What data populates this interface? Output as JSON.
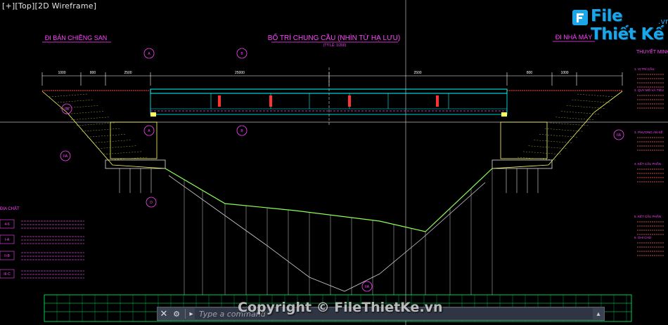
{
  "viewport": {
    "label": "[+][Top][2D Wireframe]"
  },
  "drawing": {
    "title": "BỐ TRÍ CHUNG CẦU (NHÌN TỪ HẠ LƯU)",
    "scale": "(TỶ LỆ: 1/200)",
    "left_heading": "ĐI BẢN CHIỀNG SAN",
    "right_heading": "ĐI NHÀ MÁY",
    "notes_heading": "THUYẾT MINH",
    "notes_items": [
      "1. VỊ TRÍ CẦU:",
      "2. QUY MÔ VÀ TIÊU",
      "3. PHƯƠNG ÁN KẾ",
      "4. KẾT CẤU PHẦN",
      "5. KẾT CẤU PHẦN",
      "6. GHI CHÚ"
    ],
    "geology_heading": "ĐỊA CHẤT",
    "layer_labels": [
      "4-6",
      "I-A",
      "II-B",
      "III-C"
    ],
    "circle_labels": [
      "A",
      "B",
      "A",
      "B",
      "D",
      "IIA",
      "IIB",
      "IIA",
      "IIA"
    ],
    "dims": [
      "1000",
      "800",
      "2500",
      "25000",
      "2500",
      "800",
      "1000"
    ],
    "colors": {
      "background": "#000000",
      "beam": "#00ffff",
      "dim": "#ffffff",
      "ground": "#8cff5a",
      "annotation": "#ff44ff",
      "truss": "#ffff66",
      "pier": "#e0e0e0",
      "water": "#ff3333"
    }
  },
  "logo": {
    "main": "File Thiết Kế",
    "sub": ".vn"
  },
  "watermark": "Copyright © FileThietKe.vn",
  "command": {
    "close_icon": "✕",
    "wrench_icon": "🔧",
    "prompt_icon": "▸",
    "placeholder": "Type a command",
    "menu_icon": "▴"
  }
}
